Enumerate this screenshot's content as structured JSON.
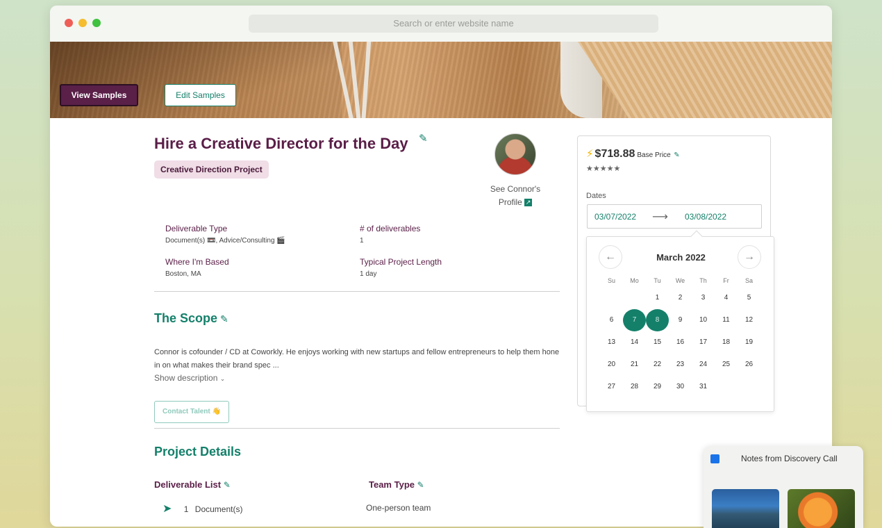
{
  "browser": {
    "url_placeholder": "Search or enter website name"
  },
  "hero": {
    "view_samples": "View Samples",
    "edit_samples": "Edit Samples"
  },
  "project": {
    "title": "Hire a Creative Director for the Day",
    "tag": "Creative Direction Project",
    "profile_link_line1": "See Connor's",
    "profile_link_line2": "Profile",
    "meta": [
      {
        "label": "Deliverable Type",
        "value": "Document(s) 📼, Advice/Consulting 🎬"
      },
      {
        "label": "# of deliverables",
        "value": "1"
      },
      {
        "label": "Where I'm Based",
        "value": "Boston, MA"
      },
      {
        "label": "Typical Project Length",
        "value": "1 day"
      }
    ],
    "scope_heading": "The Scope",
    "scope_text": "Connor is cofounder / CD at Coworkly. He enjoys working with new startups and fellow entrepreneurs to help them hone in on what makes their brand spec ...",
    "show_description": "Show description",
    "contact_talent": "Contact Talent 👋",
    "details_heading": "Project Details",
    "deliverable_list_label": "Deliverable List",
    "deliverable_count": "1",
    "deliverable_item": "Document(s)",
    "team_type_label": "Team Type",
    "team_type_value": "One-person team"
  },
  "booking": {
    "price": "$718.88",
    "price_label": "Base Price",
    "stars": "★★★★★",
    "dates_label": "Dates",
    "start_date": "03/07/2022",
    "end_date": "03/08/2022"
  },
  "calendar": {
    "month": "March 2022",
    "weekdays": [
      "Su",
      "Mo",
      "Tu",
      "We",
      "Th",
      "Fr",
      "Sa"
    ],
    "first_weekday_index": 2,
    "days_in_month": 31,
    "selected": [
      7,
      8
    ]
  },
  "notes_widget": {
    "title": "Notes from Discovery Call"
  },
  "colors": {
    "brand_purple": "#5a1e47",
    "brand_green": "#14806a",
    "price_bolt": "#f0b400"
  }
}
